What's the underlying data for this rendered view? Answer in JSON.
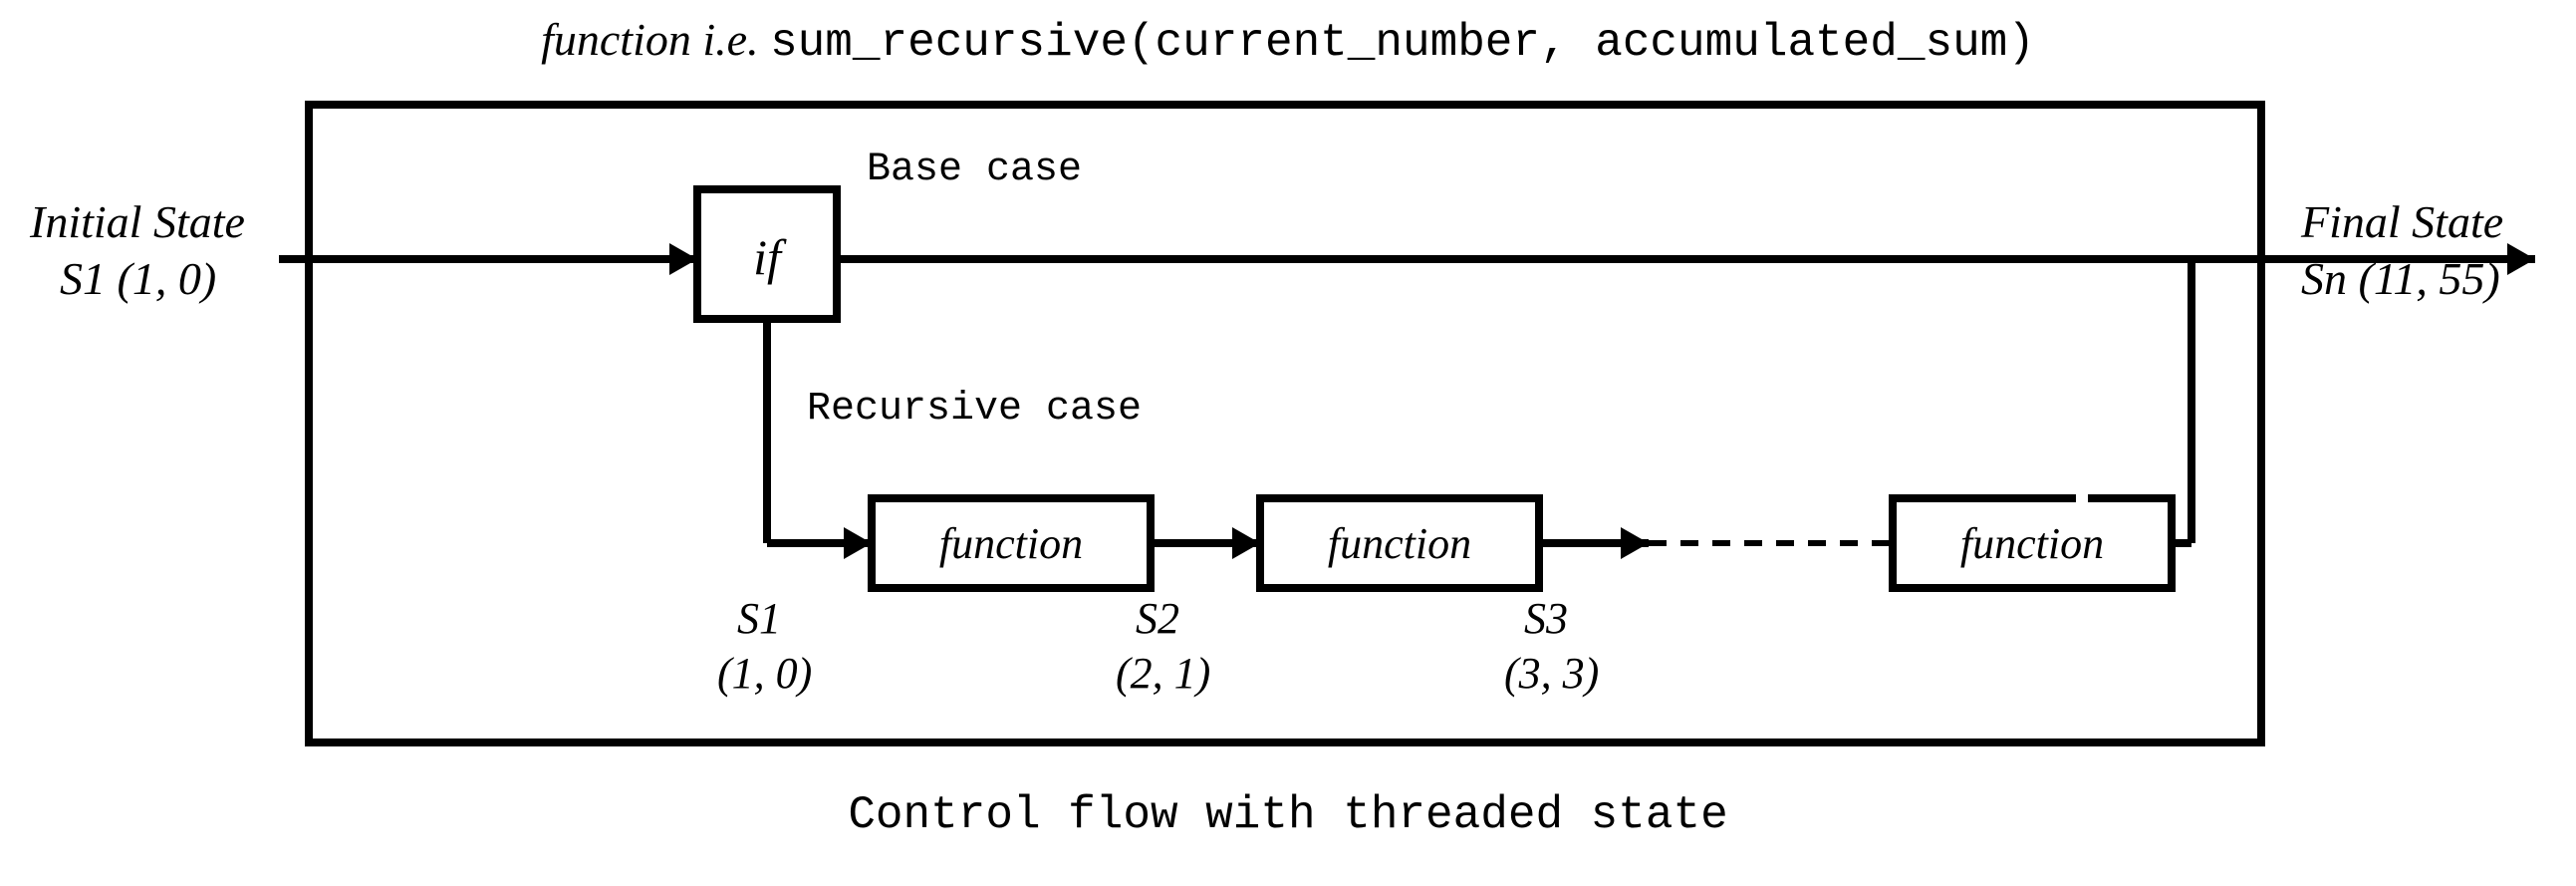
{
  "title": {
    "prefix_italic": "function i.e. ",
    "code": "sum_recursive(current_number, accumulated_sum)"
  },
  "caption": "Control flow with threaded state",
  "initial_state": {
    "label": "Initial State",
    "value": "S1 (1, 0)"
  },
  "final_state": {
    "label": "Final State",
    "value": "Sn (11, 55)"
  },
  "if_label": "if",
  "base_case_label": "Base case",
  "recursive_case_label": "Recursive case",
  "function_box_label": "function",
  "states": {
    "s1": {
      "name": "S1",
      "tuple": "(1, 0)"
    },
    "s2": {
      "name": "S2",
      "tuple": "(2, 1)"
    },
    "s3": {
      "name": "S3",
      "tuple": "(3, 3)"
    }
  }
}
